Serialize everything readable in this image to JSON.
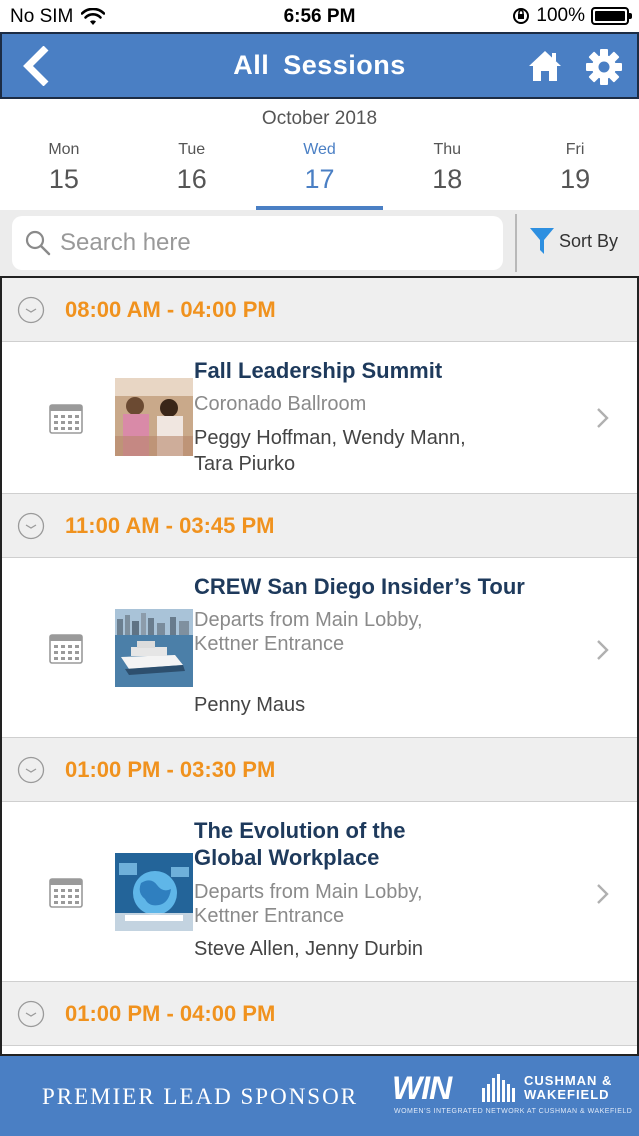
{
  "status_bar": {
    "carrier": "No SIM",
    "time": "6:56 PM",
    "battery": "100%",
    "battery_level": 1.0
  },
  "header": {
    "title": "All  Sessions",
    "back_icon": "chevron-left-icon",
    "home_icon": "home-icon",
    "settings_icon": "gear-icon"
  },
  "calendar": {
    "month": "October 2018",
    "days": [
      {
        "name": "Mon",
        "num": "15"
      },
      {
        "name": "Tue",
        "num": "16"
      },
      {
        "name": "Wed",
        "num": "17"
      },
      {
        "name": "Thu",
        "num": "18"
      },
      {
        "name": "Fri",
        "num": "19"
      }
    ],
    "selected": "Wed"
  },
  "search": {
    "placeholder": "Search here",
    "value": ""
  },
  "sort": {
    "label": "Sort By"
  },
  "sessions": [
    {
      "time": "08:00 AM - 04:00 PM",
      "title": "Fall Leadership Summit",
      "room": "Coronado Ballroom",
      "speakers": "Peggy Hoffman, Wendy Mann, Tara Piurko"
    },
    {
      "time": "11:00 AM - 03:45 PM",
      "title": "CREW San Diego Insider’s Tour",
      "room": "Departs from Main Lobby, Kettner Entrance",
      "speakers": "Penny Maus"
    },
    {
      "time": "01:00 PM - 03:30 PM",
      "title": "The Evolution of the Global Workplace",
      "room": "Departs from Main Lobby, Kettner Entrance",
      "speakers": "Steve Allen, Jenny Durbin"
    },
    {
      "time": "01:00 PM - 04:00 PM"
    }
  ],
  "footer": {
    "sponsor_label": "PREMIER LEAD SPONSOR",
    "logo_win": "WIN",
    "logo_cushman": "CUSHMAN &",
    "logo_wakefield": "WAKEFIELD",
    "logo_tagline": "WOMEN'S INTEGRATED NETWORK AT CUSHMAN & WAKEFIELD"
  },
  "colors": {
    "brand_blue": "#4a7fc4",
    "time_orange": "#f0921e",
    "title_navy": "#1e3a5c"
  }
}
